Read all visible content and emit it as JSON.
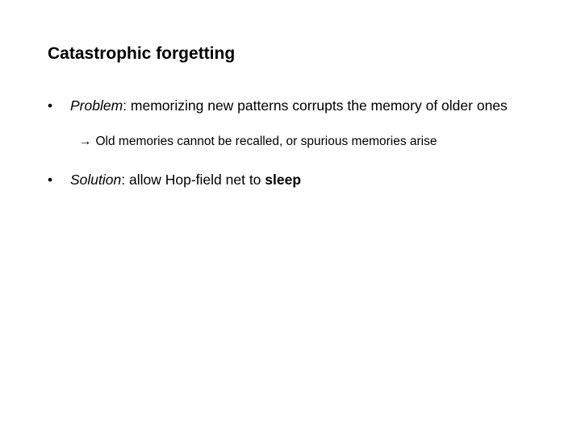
{
  "slide": {
    "title": "Catastrophic forgetting",
    "bullets": [
      {
        "marker": "•",
        "term": "Problem",
        "separator": ":",
        "text": " memorizing new patterns corrupts the memory of older ones"
      },
      {
        "marker": "•",
        "term": "Solution",
        "separator": ":",
        "text": " allow Hop-field net to ",
        "emphasis": "sleep"
      }
    ],
    "sub_point": {
      "icon": "→",
      "text": "Old memories cannot be recalled, or spurious memories arise"
    }
  }
}
